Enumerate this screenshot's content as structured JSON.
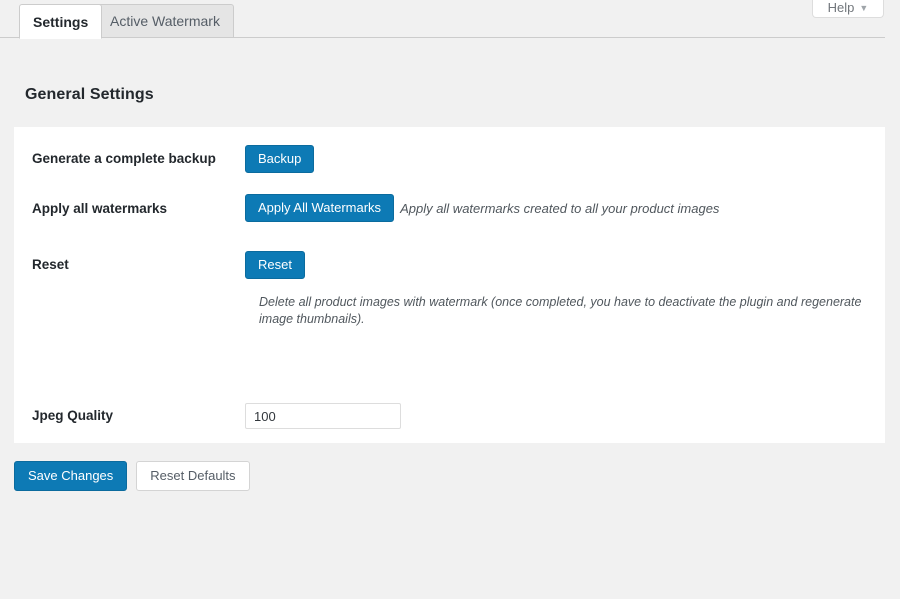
{
  "help": {
    "label": "Help",
    "caret_icon": "chevron-down-icon"
  },
  "tabs": [
    {
      "label": "Settings",
      "active": true
    },
    {
      "label": "Active Watermark",
      "active": false
    }
  ],
  "page_title": "General Settings",
  "settings": {
    "rows": [
      {
        "label": "Generate a complete backup",
        "button": "Backup",
        "hint": ""
      },
      {
        "label": "Apply all watermarks",
        "button": "Apply All Watermarks",
        "hint": "Apply all watermarks created to all your product images"
      },
      {
        "label": "Reset",
        "button": "Reset",
        "hint": "Delete all product images with watermark (once completed, you have to deactivate the plugin and regenerate image thumbnails)."
      },
      {
        "label": "Jpeg Quality",
        "value": "100",
        "placeholder": ""
      }
    ]
  },
  "footer": {
    "save_label": "Save Changes",
    "reset_label": "Reset Defaults"
  },
  "colors": {
    "primary": "#0d7ab5",
    "page_background": "#f1f1f1",
    "panel_background": "#ffffff",
    "text": "#23282d",
    "hint_text": "#50575d"
  }
}
